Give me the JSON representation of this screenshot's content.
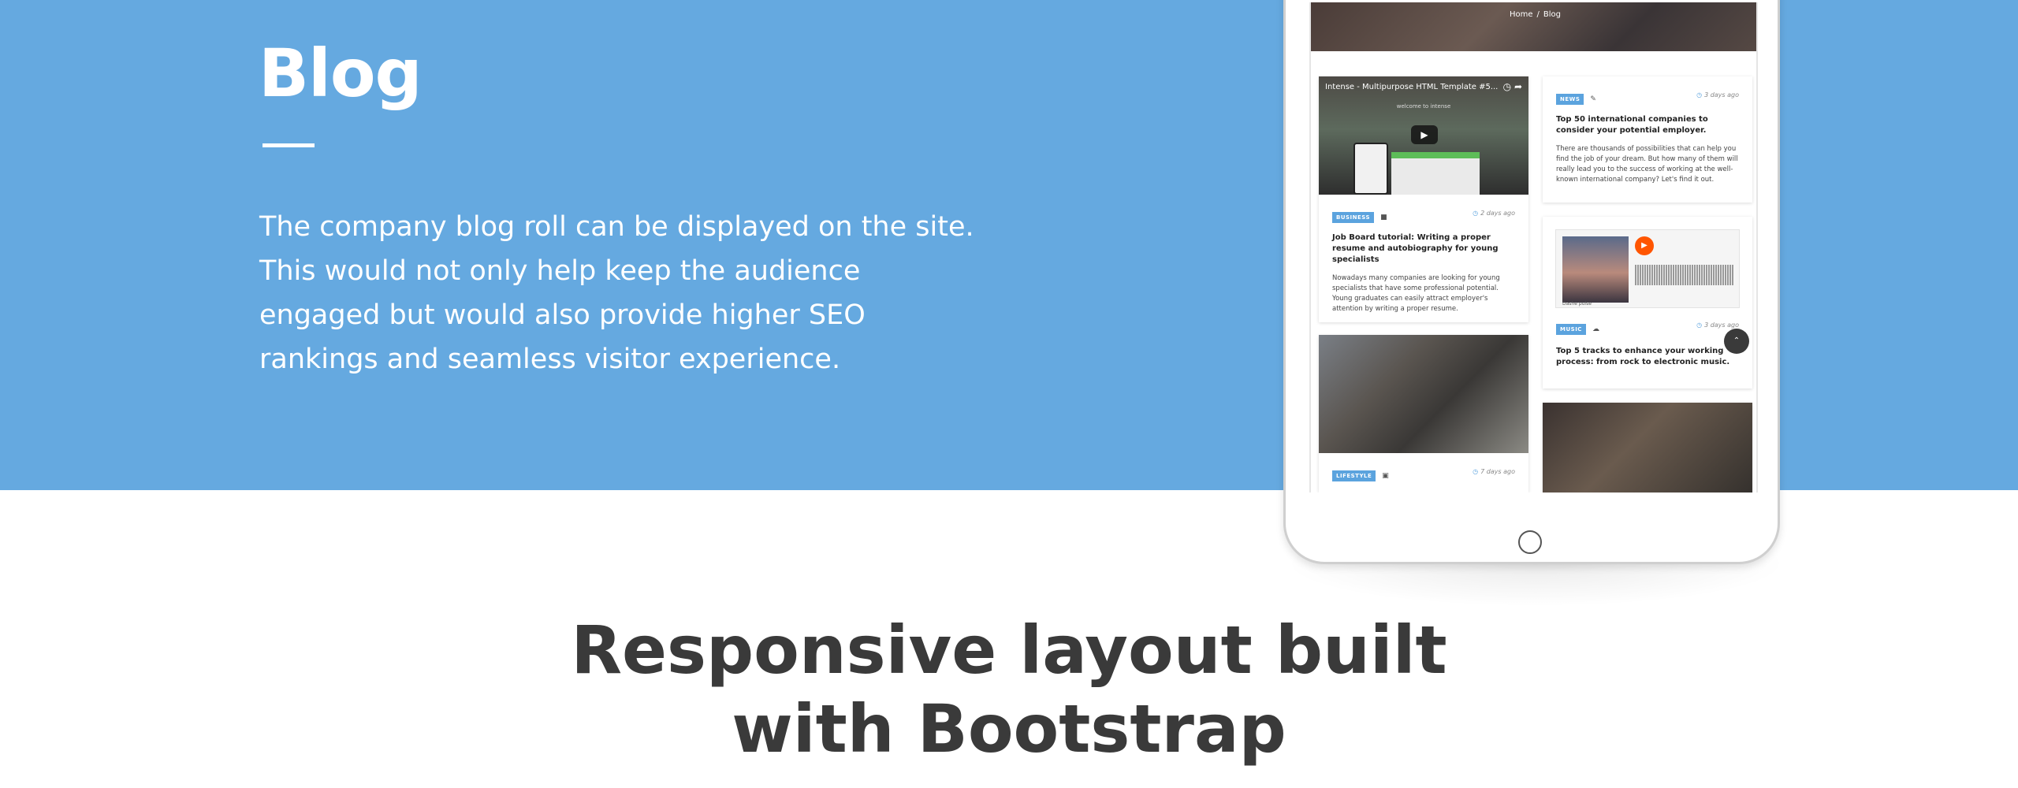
{
  "hero": {
    "title": "Blog",
    "description": "The company blog roll can be displayed on the site. This would not only help keep the audience engaged but would also provide higher SEO rankings and seamless visitor experience."
  },
  "bottom": {
    "heading_line1": "Responsive layout built",
    "heading_line2": "with Bootstrap"
  },
  "screen": {
    "breadcrumb_home": "Home",
    "breadcrumb_sep": "/",
    "breadcrumb_current": "Blog",
    "posts": [
      {
        "video_title": "Intense - Multipurpose HTML Template #5...",
        "video_caption": "welcome to intense",
        "category": "BUSINESS",
        "icon": "video-camera-icon",
        "date": "2 days ago",
        "title": "Job Board tutorial: Writing a proper resume and autobiography for young specialists",
        "excerpt": "Nowadays many companies are looking for young specialists that have some professional potential. Young graduates can easily attract employer's attention by writing a proper resume."
      },
      {
        "category": "NEWS",
        "icon": "pencil-icon",
        "date": "3 days ago",
        "title": "Top 50 international companies to consider your potential employer.",
        "excerpt": "There are thousands of possibilities that can help you find the job of your dream. But how many of them will really lead you to the success of working at the well-known international company? Let's find it out."
      },
      {
        "category": "MUSIC",
        "icon": "soundcloud-icon",
        "date": "3 days ago",
        "title": "Top 5 tracks to enhance your working process: from rock to electronic music.",
        "player_name": "Dashe pulse"
      },
      {
        "category": "LIFESTYLE",
        "icon": "camera-icon",
        "date": "7 days ago"
      }
    ]
  },
  "colors": {
    "hero_bg": "#65a9e0",
    "badge": "#5ba3de",
    "heading": "#3a3a3a"
  }
}
